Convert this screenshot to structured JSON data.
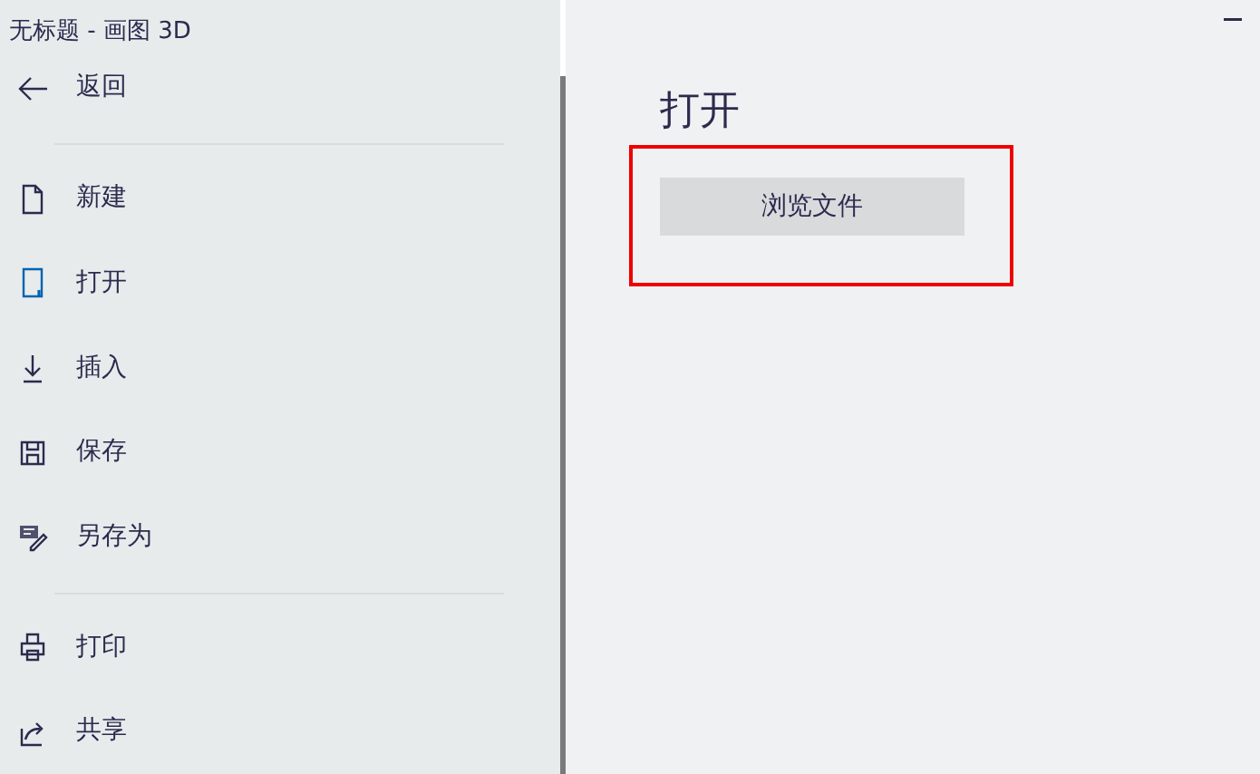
{
  "window": {
    "title": "无标题 - 画图 3D"
  },
  "sidebar": {
    "back": "返回",
    "groups": [
      [
        {
          "label": "新建",
          "selected": false
        },
        {
          "label": "打开",
          "selected": true
        },
        {
          "label": "插入",
          "selected": false
        },
        {
          "label": "保存",
          "selected": false
        },
        {
          "label": "另存为",
          "selected": false
        }
      ],
      [
        {
          "label": "打印",
          "selected": false
        },
        {
          "label": "共享",
          "selected": false
        }
      ]
    ]
  },
  "main": {
    "heading": "打开",
    "button": {
      "label": "浏览文件",
      "highlighted": true
    }
  }
}
